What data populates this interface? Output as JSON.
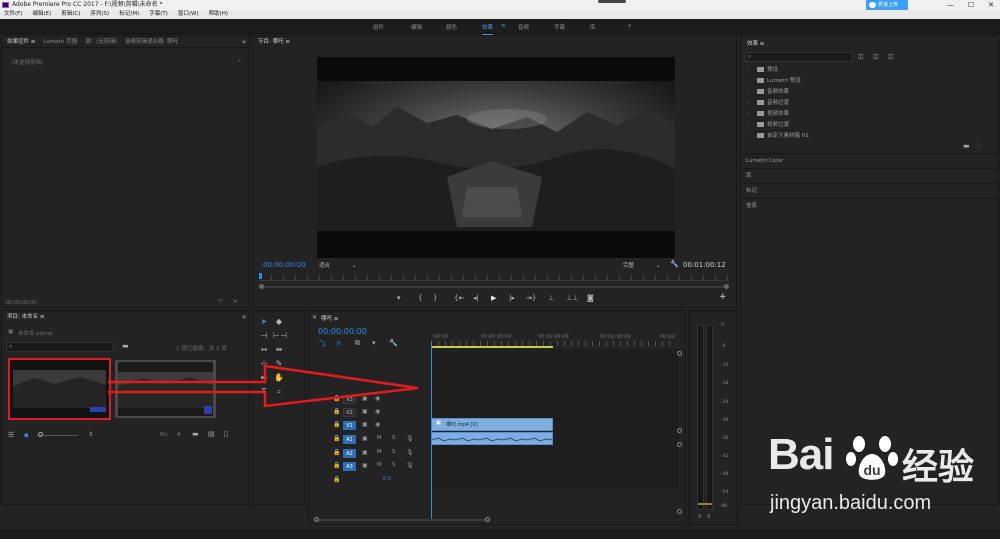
{
  "app": {
    "title": "Adobe Premiere Pro CC 2017 - F:\\视频\\剪辑\\未命名 *",
    "menu": [
      "文件(F)",
      "编辑(E)",
      "剪辑(C)",
      "序列(S)",
      "标记(M)",
      "字幕(T)",
      "窗口(W)",
      "帮助(H)"
    ],
    "window_controls": [
      "—",
      "☐",
      "✕"
    ],
    "upload_label": "极速上传"
  },
  "workspace": {
    "tabs": [
      "组件",
      "编辑",
      "颜色",
      "效果",
      "音频",
      "字幕",
      "库"
    ],
    "active": "效果",
    "menu_glyph": "≡",
    "more": "»"
  },
  "source_panel": {
    "tabs": [
      "效果控件 ≡",
      "Lumetri 范围",
      "源：(无剪辑)",
      "音频剪辑混合器: 哪吒"
    ],
    "more": "»",
    "no_clip": "（未选择剪辑）",
    "timecode": "00:00:00:00"
  },
  "program_panel": {
    "tab": "节目: 哪吒 ≡",
    "timecode_current": "00:00:00:00",
    "fit": "适合",
    "quality": "完整",
    "timecode_duration": "00:01:00:12"
  },
  "project_panel": {
    "tab": "项目: 未命名 ≡",
    "more": "»",
    "project_file": "未命名.prproj",
    "selection_info": "1 项已选择，共 2 项",
    "bin_label": "Bin"
  },
  "timeline": {
    "tab": "哪吒 ≡",
    "timecode": "00:00:00:00",
    "ruler": [
      ":00:00",
      "00:00:30:00",
      "00:01:00:00",
      "00:01:30:00",
      "00:02:"
    ],
    "tracks_video": [
      "V3",
      "V2",
      "V1"
    ],
    "tracks_audio": [
      "A1",
      "A2",
      "A3"
    ],
    "track_buttons": [
      "M",
      "S"
    ],
    "master_value": "0.0",
    "video_clip_label": "哪吒.mp4 [V]"
  },
  "effects_panel": {
    "title": "效果 ≡",
    "categories": [
      "预设",
      "Lumetri 预设",
      "音频效果",
      "音频过渡",
      "视频效果",
      "视频过渡",
      "自定义素材箱 01"
    ],
    "sections": [
      "Lumetri Color",
      "库",
      "标记",
      "信息"
    ]
  },
  "audio_meter": {
    "scale": [
      "0",
      "-6",
      "-12",
      "-18",
      "-24",
      "-30",
      "-36",
      "-42",
      "-48",
      "-54",
      "dB"
    ],
    "solo": [
      "S",
      "S"
    ]
  },
  "watermark": {
    "brand": "Bai",
    "brand_tail": "经验",
    "url": "jingyan.baidu.com"
  },
  "colors": {
    "accent_blue": "#2d8ceb",
    "clip_blue": "#7eaee0",
    "annotation_red": "#e21c1c",
    "playhead": "#2d8ceb"
  }
}
